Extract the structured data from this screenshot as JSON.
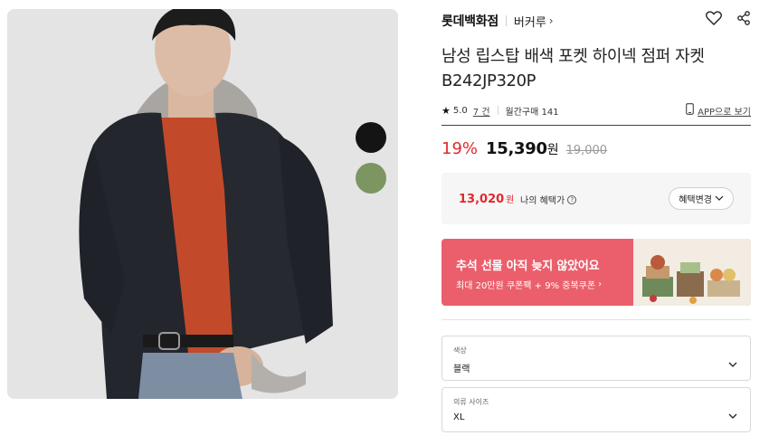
{
  "brand": {
    "name": "롯데백화점",
    "sub_brand": "버커루"
  },
  "product": {
    "title": "남성 립스탑 배색 포켓 하이넥 점퍼 자켓 B242JP320P",
    "rating": "5.0",
    "review_count": "7 건",
    "monthly_purchases": "월간구매 141"
  },
  "app_link": "APP으로 보기",
  "price": {
    "discount": "19%",
    "amount": "15,390",
    "currency": "원",
    "original": "19,000"
  },
  "benefit": {
    "price": "13,020",
    "currency": "원",
    "label": "나의 혜택가",
    "change_button": "혜택변경"
  },
  "promo": {
    "title": "추석 선물 아직 늦지 않았어요",
    "subtitle": "최대 20만원 쿠폰팩 + 9% 중복쿠폰"
  },
  "options": {
    "color": {
      "label": "색상",
      "value": "블랙"
    },
    "size": {
      "label": "의류 사이즈",
      "value": "XL"
    }
  },
  "swatches": [
    {
      "name": "black",
      "color": "#141414"
    },
    {
      "name": "green",
      "color": "#7c9561"
    }
  ],
  "colors": {
    "accent_red": "#e3272c",
    "promo_bg": "#eb5f6c"
  }
}
